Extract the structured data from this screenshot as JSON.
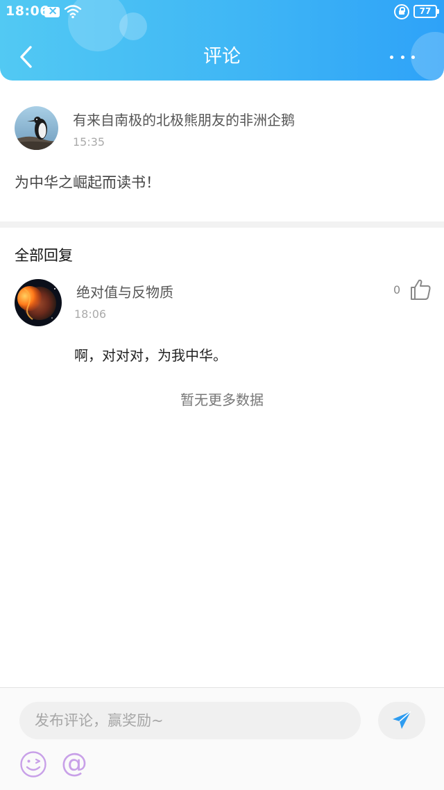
{
  "status_bar": {
    "time": "18:06",
    "battery": "77",
    "icons": [
      "notification-x-icon",
      "wifi-icon",
      "rotation-lock-icon",
      "battery-icon"
    ]
  },
  "header": {
    "title": "评论",
    "back_icon": "chevron-left-icon",
    "more_icon": "more-dots-icon",
    "gradient_colors": [
      "#52c9f3",
      "#2ea2f8"
    ]
  },
  "post": {
    "author": "有来自南极的北极熊朋友的非洲企鹅",
    "time": "15:35",
    "content": "为中华之崛起而读书！",
    "avatar_icon": "penguin-avatar"
  },
  "replies_section": {
    "title": "全部回复",
    "items": [
      {
        "author": "绝对值与反物质",
        "time": "18:06",
        "likes": "0",
        "content": "啊，对对对，为我中华。",
        "avatar_icon": "planet-avatar",
        "like_icon": "thumbs-up-icon"
      }
    ],
    "empty_text": "暂无更多数据"
  },
  "composer": {
    "placeholder": "发布评论，赢奖励~",
    "send_icon": "paper-plane-icon",
    "emoji_icon": "emoji-icon",
    "mention_symbol": "@",
    "accent_color": "#2ea2f8"
  }
}
